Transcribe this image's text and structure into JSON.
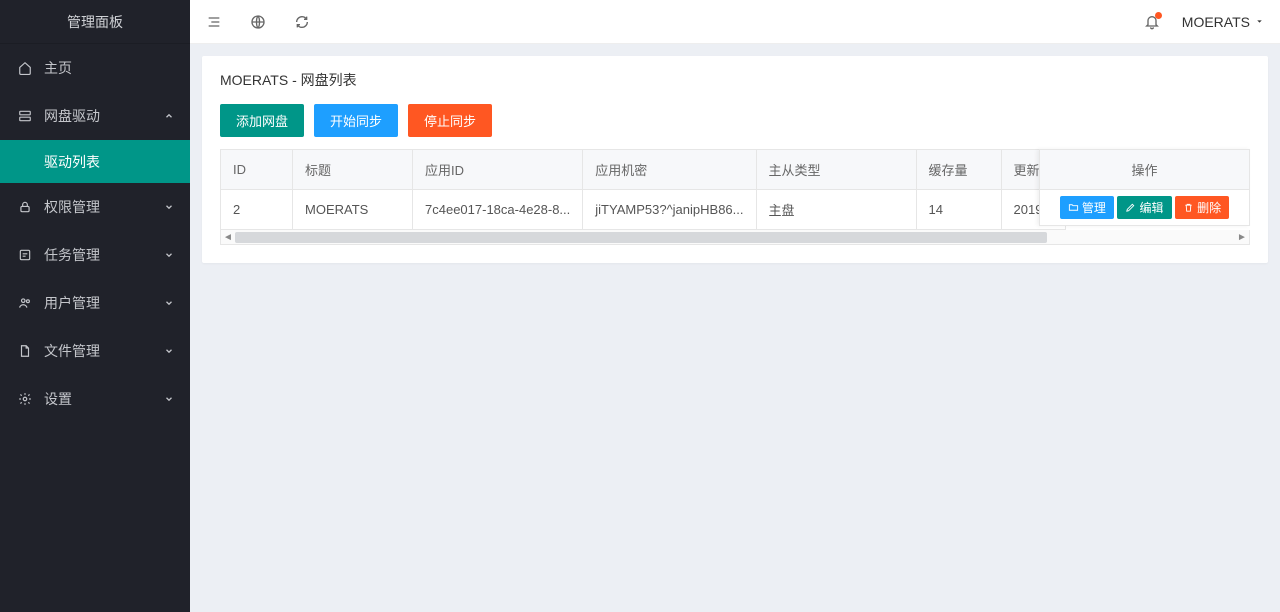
{
  "sidebar": {
    "title": "管理面板",
    "items": [
      {
        "icon": "home",
        "label": "主页",
        "expandable": false
      },
      {
        "icon": "drive",
        "label": "网盘驱动",
        "expandable": true,
        "open": true,
        "children": [
          {
            "label": "驱动列表",
            "active": true
          }
        ]
      },
      {
        "icon": "lock",
        "label": "权限管理",
        "expandable": true
      },
      {
        "icon": "task",
        "label": "任务管理",
        "expandable": true
      },
      {
        "icon": "users",
        "label": "用户管理",
        "expandable": true
      },
      {
        "icon": "file",
        "label": "文件管理",
        "expandable": true
      },
      {
        "icon": "gear",
        "label": "设置",
        "expandable": true
      }
    ]
  },
  "topbar": {
    "user": "MOERATS"
  },
  "panel": {
    "title": "MOERATS - 网盘列表",
    "buttons": {
      "add": "添加网盘",
      "startSync": "开始同步",
      "stopSync": "停止同步"
    },
    "columns": {
      "id": "ID",
      "title": "标题",
      "appId": "应用ID",
      "appSecret": "应用机密",
      "masterSlave": "主从类型",
      "cache": "缓存量",
      "updated": "更新时",
      "ops": "操作"
    },
    "row": {
      "id": "2",
      "title": "MOERATS",
      "appId": "7c4ee017-18ca-4e28-8...",
      "appSecret": "jiTYAMP53?^janipHB86...",
      "masterSlave": "主盘",
      "cache": "14",
      "updated": "2019"
    },
    "ops": {
      "manage": "管理",
      "edit": "编辑",
      "delete": "删除"
    }
  }
}
